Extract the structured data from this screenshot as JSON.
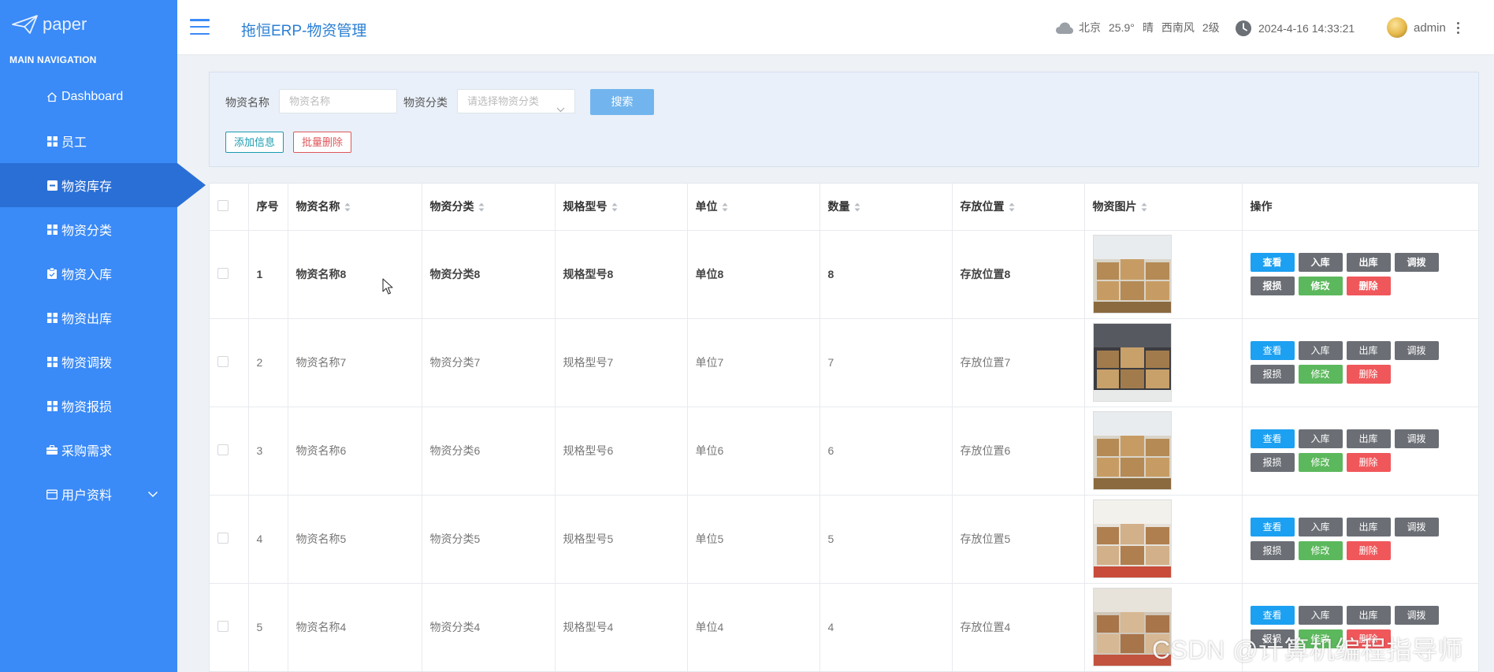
{
  "colors": {
    "sidebar": "#3a8af7",
    "sidebar_active": "#2a6fd6",
    "title": "#2a7fd4",
    "view_btn": "#1ca0f1",
    "gray_btn": "#6b6f75",
    "edit_btn": "#5cb85c",
    "delete_btn": "#f0575a"
  },
  "logo": {
    "text": "paper",
    "icon": "paper-plane-icon"
  },
  "sidebar": {
    "heading": "MAIN NAVIGATION",
    "items": [
      {
        "label": "Dashboard",
        "icon": "home-icon"
      },
      {
        "label": "员工",
        "icon": "grid-icon"
      },
      {
        "label": "物资库存",
        "icon": "inventory-icon",
        "active": true
      },
      {
        "label": "物资分类",
        "icon": "grid-icon"
      },
      {
        "label": "物资入库",
        "icon": "clipboard-icon"
      },
      {
        "label": "物资出库",
        "icon": "grid-icon"
      },
      {
        "label": "物资调拨",
        "icon": "grid-icon"
      },
      {
        "label": "物资报损",
        "icon": "grid-icon"
      },
      {
        "label": "采购需求",
        "icon": "briefcase-icon"
      },
      {
        "label": "用户资料",
        "icon": "calendar-icon",
        "expandable": true
      }
    ]
  },
  "header": {
    "title": "拖恒ERP-物资管理",
    "weather": {
      "icon": "cloud-icon",
      "city": "北京",
      "temp": "25.9°",
      "condition": "晴",
      "wind": "西南风",
      "level": "2级"
    },
    "datetime": "2024-4-16 14:33:21",
    "user": "admin"
  },
  "search": {
    "name_label": "物资名称",
    "name_placeholder": "物资名称",
    "category_label": "物资分类",
    "category_placeholder": "请选择物资分类",
    "search_button": "搜索",
    "add_button": "添加信息",
    "batch_delete_button": "批量删除"
  },
  "table": {
    "columns": [
      "序号",
      "物资名称",
      "物资分类",
      "规格型号",
      "单位",
      "数量",
      "存放位置",
      "物资图片",
      "操作"
    ],
    "actions": [
      "查看",
      "入库",
      "出库",
      "调拨",
      "报损",
      "修改",
      "删除"
    ],
    "rows": [
      {
        "index": "1",
        "name": "物资名称8",
        "category": "物资分类8",
        "spec": "规格型号8",
        "unit": "单位8",
        "qty": "8",
        "location": "存放位置8"
      },
      {
        "index": "2",
        "name": "物资名称7",
        "category": "物资分类7",
        "spec": "规格型号7",
        "unit": "单位7",
        "qty": "7",
        "location": "存放位置7"
      },
      {
        "index": "3",
        "name": "物资名称6",
        "category": "物资分类6",
        "spec": "规格型号6",
        "unit": "单位6",
        "qty": "6",
        "location": "存放位置6"
      },
      {
        "index": "4",
        "name": "物资名称5",
        "category": "物资分类5",
        "spec": "规格型号5",
        "unit": "单位5",
        "qty": "5",
        "location": "存放位置5"
      },
      {
        "index": "5",
        "name": "物资名称4",
        "category": "物资分类4",
        "spec": "规格型号4",
        "unit": "单位4",
        "qty": "4",
        "location": "存放位置4"
      }
    ]
  },
  "watermark": "CSDN @计算机编程指导师"
}
